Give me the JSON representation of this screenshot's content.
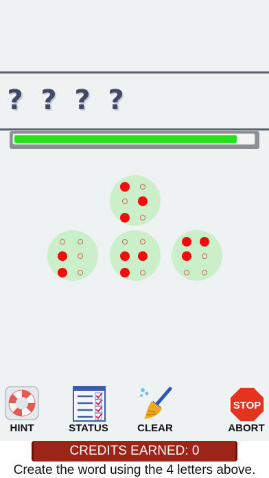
{
  "answer": {
    "slots": [
      "?",
      "?",
      "?",
      "?"
    ]
  },
  "progress": {
    "fraction": 0.93
  },
  "braille_cells": [
    {
      "dots": [
        true,
        false,
        true,
        false,
        true,
        false
      ]
    },
    {
      "dots": [
        false,
        true,
        true,
        false,
        false,
        false
      ]
    },
    {
      "dots": [
        false,
        true,
        true,
        false,
        true,
        false
      ]
    },
    {
      "dots": [
        true,
        true,
        false,
        true,
        false,
        false
      ]
    }
  ],
  "toolbar": {
    "hint_label": "HINT",
    "status_label": "STATUS",
    "clear_label": "CLEAR",
    "abort_label": "ABORT",
    "stop_sign_text": "STOP"
  },
  "credits": {
    "label": "CREDITS EARNED: 0"
  },
  "instruction": "Create the word using the 4 letters above.",
  "colors": {
    "progress_fill": "#27e11d",
    "cell_background": "#cbf0c9",
    "dot_raised": "#f20d0d",
    "credits_background": "#9d2418"
  }
}
